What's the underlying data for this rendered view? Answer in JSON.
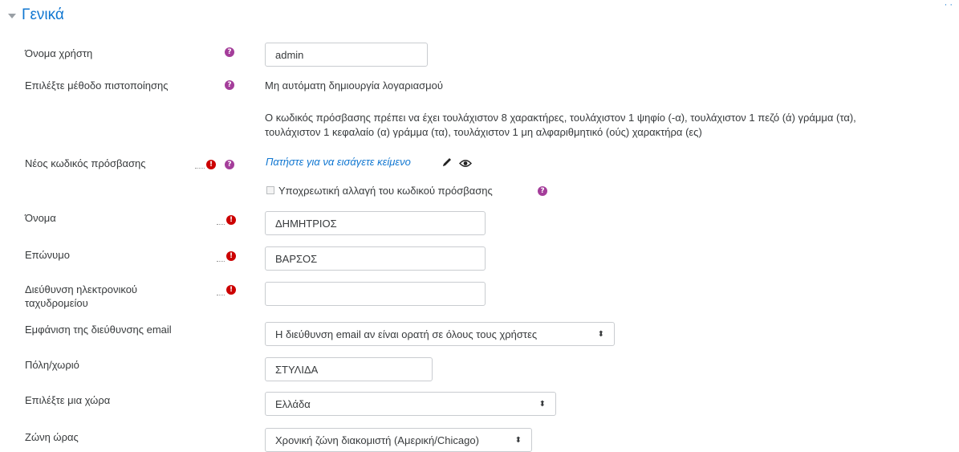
{
  "section": {
    "title": "Γενικά",
    "corner_mark": "· ·"
  },
  "fields": {
    "username": {
      "label": "Όνομα χρήστη",
      "value": "admin"
    },
    "auth": {
      "label": "Επιλέξτε μέθοδο πιστοποίησης",
      "value": "Μη αυτόματη δημιουργία λογαριασμού"
    },
    "password_rules": {
      "line1": "Ο κωδικός πρόσβασης πρέπει να έχει τουλάχιστον 8 χαρακτήρες, τουλάχιστον 1 ψηφίο (-α), τουλάχιστον 1 πεζό (ά) γράμμα (τα),",
      "line2": "τουλάχιστον 1 κεφαλαίο (α) γράμμα (τα), τουλάχιστον 1 μη αλφαριθμητικό (ούς) χαρακτήρα (ες)"
    },
    "new_password": {
      "label": "Νέος κωδικός πρόσβασης",
      "link_text": "Πατήστε για να εισάγετε κείμενο"
    },
    "force_change": {
      "label": "Υποχρεωτική αλλαγή του κωδικού πρόσβασης",
      "checked": false
    },
    "firstname": {
      "label": "Όνομα",
      "value": "ΔΗΜΗΤΡΙΟΣ"
    },
    "lastname": {
      "label": "Επώνυμο",
      "value": "ΒΑΡΣΟΣ"
    },
    "email": {
      "label_line1": "Διεύθυνση ηλεκτρονικού",
      "label_line2": "ταχυδρομείου",
      "value": ""
    },
    "email_display": {
      "label": "Εμφάνιση της διεύθυνσης email",
      "selected": "Η διεύθυνση email αν είναι ορατή σε όλους τους χρήστες"
    },
    "city": {
      "label": "Πόλη/χωριό",
      "value": "ΣΤΥΛΙΔΑ"
    },
    "country": {
      "label": "Επιλέξτε μια χώρα",
      "selected": "Ελλάδα"
    },
    "timezone": {
      "label": "Ζώνη ώρας",
      "selected": "Χρονική ζώνη διακομιστή (Αμερική/Chicago)"
    }
  },
  "icons": {
    "help": "question-circle-icon",
    "required": "exclamation-circle-icon",
    "edit": "pencil-icon",
    "reveal": "eye-icon",
    "select_caret": "up-down-caret-icon"
  },
  "glyphs": {
    "help": "?",
    "required": "!",
    "caret": "⬍"
  },
  "colors": {
    "accent": "#1177d1",
    "help": "#a43d9a",
    "required": "#cc0000",
    "text": "#373a3c",
    "border": "#c9ccd0"
  }
}
